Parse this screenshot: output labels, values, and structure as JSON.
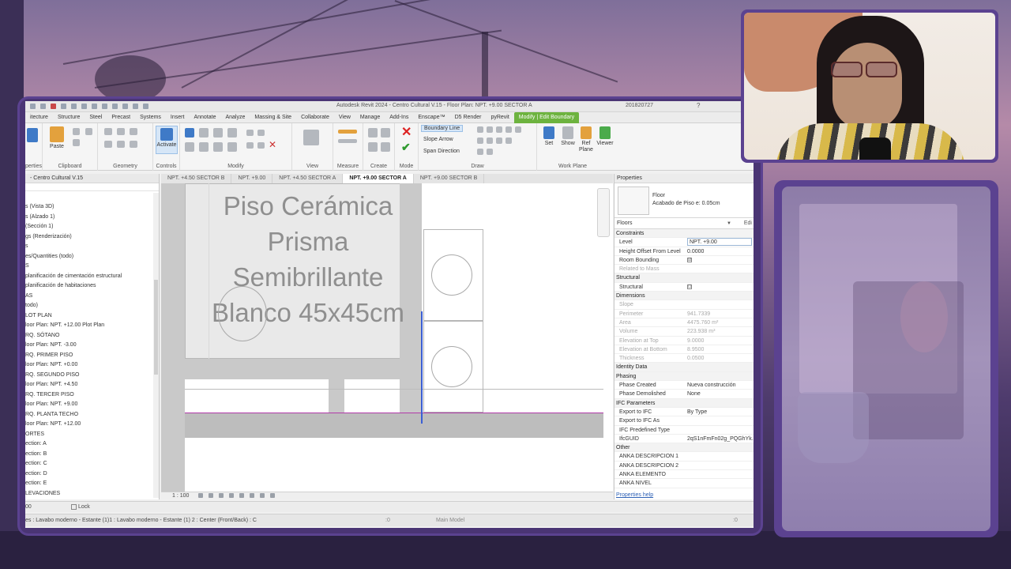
{
  "revit": {
    "window_title": "Autodesk Revit 2024 - Centro Cultural V.15 - Floor Plan: NPT. +9.00 SECTOR A",
    "user": "201820727",
    "ribbon_tabs": [
      "itecture",
      "Structure",
      "Steel",
      "Precast",
      "Systems",
      "Insert",
      "Annotate",
      "Analyze",
      "Massing & Site",
      "Collaborate",
      "View",
      "Manage",
      "Add-Ins",
      "Enscape™",
      "D5 Render",
      "pyRevit",
      "Modify | Edit Boundary"
    ],
    "panels": {
      "properties": "perties",
      "clipboard": "Clipboard",
      "geometry": "Geometry",
      "controls": "Controls",
      "modify": "Modify",
      "view": "View",
      "measure": "Measure",
      "create": "Create",
      "mode": "Mode",
      "draw": "Draw",
      "work_plane": "Work Plane"
    },
    "buttons": {
      "paste": "Paste",
      "activate": "Activate",
      "boundary_line": "Boundary Line",
      "slope_arrow": "Slope Arrow",
      "span_direction": "Span Direction",
      "set": "Set",
      "show": "Show",
      "ref_plane": "Ref Plane",
      "viewer": "Viewer"
    },
    "browser": {
      "title": "- Centro Cultural V.15",
      "items": [
        "s (Vista 3D)",
        "s (Alzado 1)",
        "(Sección 1)",
        "gs (Renderización)",
        "s",
        "es/Quantities (todo)",
        "S",
        "planificación de cimentación estructural",
        "planificación de habitaciones",
        "AS",
        "todo)",
        "LOT PLAN",
        "loor Plan: NPT. +12.00 Plot Plan",
        "RQ. SÓTANO",
        "loor Plan: NPT. -3.00",
        "RQ. PRIMER PISO",
        "loor Plan: NPT. +0.00",
        "RQ. SEGUNDO PISO",
        "loor Plan: NPT. +4.50",
        "RQ. TERCER PISO",
        "loor Plan: NPT. +9.00",
        "RQ. PLANTA TECHO",
        "loor Plan: NPT. +12.00",
        "ORTES",
        "ection: A",
        "ection: B",
        "ection: C",
        "ection: D",
        "ection: E",
        "LEVACIONES"
      ]
    },
    "view_tabs": [
      "NPT. +4.50 SECTOR B",
      "NPT. +9.00",
      "NPT. +4.50 SECTOR A",
      "NPT. +9.00 SECTOR A",
      "NPT. +9.00 SECTOR B"
    ],
    "active_view_tab": "NPT. +9.00 SECTOR A",
    "canvas_note": [
      "Piso Cerámica",
      "Prisma Semibrillante",
      "Blanco 45x45cm"
    ],
    "scale": "1 : 100",
    "properties": {
      "header": "Properties",
      "type_name": "Floor",
      "type_sub": "Acabado de Piso e: 0.05cm",
      "filter": "Floors",
      "edit_type": "Edi",
      "rows": [
        {
          "k": "Constraints",
          "v": "",
          "kind": "sec"
        },
        {
          "k": "Level",
          "v": "NPT. +9.00",
          "kind": "input"
        },
        {
          "k": "Height Offset From Level",
          "v": "0.0000",
          "kind": ""
        },
        {
          "k": "Room Bounding",
          "v": "☑",
          "kind": "check"
        },
        {
          "k": "Related to Mass",
          "v": "",
          "kind": "grey"
        },
        {
          "k": "Structural",
          "v": "",
          "kind": "sec"
        },
        {
          "k": "Structural",
          "v": "☐",
          "kind": "check"
        },
        {
          "k": "Dimensions",
          "v": "",
          "kind": "sec"
        },
        {
          "k": "Slope",
          "v": "",
          "kind": "grey"
        },
        {
          "k": "Perimeter",
          "v": "941.7339",
          "kind": "grey"
        },
        {
          "k": "Area",
          "v": "4475.760 m²",
          "kind": "grey"
        },
        {
          "k": "Volume",
          "v": "223.938 m³",
          "kind": "grey"
        },
        {
          "k": "Elevation at Top",
          "v": "9.0000",
          "kind": "grey"
        },
        {
          "k": "Elevation at Bottom",
          "v": "8.9500",
          "kind": "grey"
        },
        {
          "k": "Thickness",
          "v": "0.0500",
          "kind": "grey"
        },
        {
          "k": "Identity Data",
          "v": "",
          "kind": "sec"
        },
        {
          "k": "Phasing",
          "v": "",
          "kind": "sec"
        },
        {
          "k": "Phase Created",
          "v": "Nueva construcción",
          "kind": ""
        },
        {
          "k": "Phase Demolished",
          "v": "None",
          "kind": ""
        },
        {
          "k": "IFC Parameters",
          "v": "",
          "kind": "sec"
        },
        {
          "k": "Export to IFC",
          "v": "By Type",
          "kind": ""
        },
        {
          "k": "Export to IFC As",
          "v": "",
          "kind": ""
        },
        {
          "k": "IFC Predefined Type",
          "v": "",
          "kind": ""
        },
        {
          "k": "IfcGUID",
          "v": "2qS1nFmFn02g_PQGhYk...",
          "kind": ""
        },
        {
          "k": "Other",
          "v": "",
          "kind": "sec"
        },
        {
          "k": "ANKA DESCRIPCION 1",
          "v": "",
          "kind": ""
        },
        {
          "k": "ANKA DESCRIPCION 2",
          "v": "",
          "kind": ""
        },
        {
          "k": "ANKA ELEMENTO",
          "v": "",
          "kind": ""
        },
        {
          "k": "ANKA NIVEL",
          "v": "",
          "kind": ""
        }
      ],
      "help": "Properties help",
      "apply": "Ap"
    },
    "options_bar": {
      "zero": "00",
      "lock": "Lock"
    },
    "status": {
      "text": "es : Lavabo moderno - Estante (1)1 : Lavabo moderno - Estante (1) 2 : Center (Front/Back) : C",
      "zero1": ":0",
      "main_model": "Main Model",
      "zero2": ":0"
    }
  },
  "colors": {
    "modify_tab": "#6db33f",
    "boundary_magenta": "#b03aa8",
    "sketch_blue": "#3b5fd4",
    "frame_purple": "#5b4290"
  }
}
